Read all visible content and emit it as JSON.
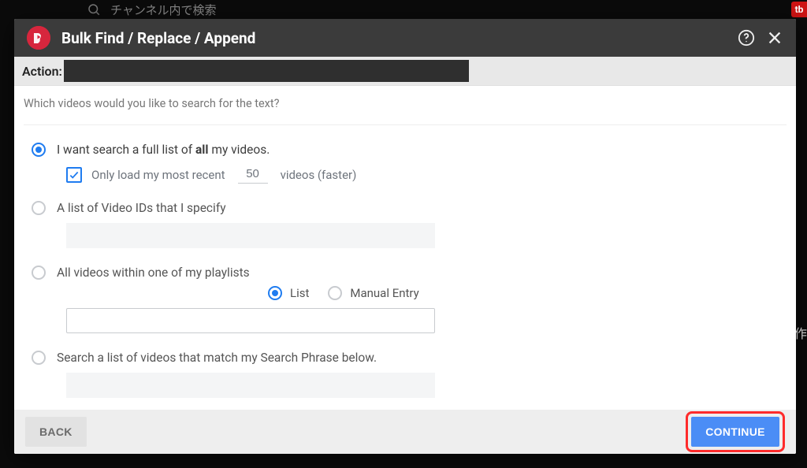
{
  "background": {
    "search_placeholder": "チャンネル内で検索",
    "right_badge": "作"
  },
  "modal": {
    "title": "Bulk Find / Replace / Append",
    "action_label": "Action:"
  },
  "body": {
    "question": "Which videos would you like to search for the text?",
    "options": {
      "full_list": {
        "label_prefix": "I want search a full list of ",
        "label_bold": "all",
        "label_suffix": " my videos.",
        "only_recent_prefix": "Only load my most recent",
        "only_recent_count": "50",
        "only_recent_suffix": "videos (faster)"
      },
      "video_ids": {
        "label": "A list of Video IDs that I specify"
      },
      "playlists": {
        "label": "All videos within one of my playlists",
        "mode_list": "List",
        "mode_manual": "Manual Entry"
      },
      "search_phrase": {
        "label": "Search a list of videos that match my Search Phrase below."
      }
    }
  },
  "footer": {
    "back": "BACK",
    "continue": "CONTINUE"
  }
}
